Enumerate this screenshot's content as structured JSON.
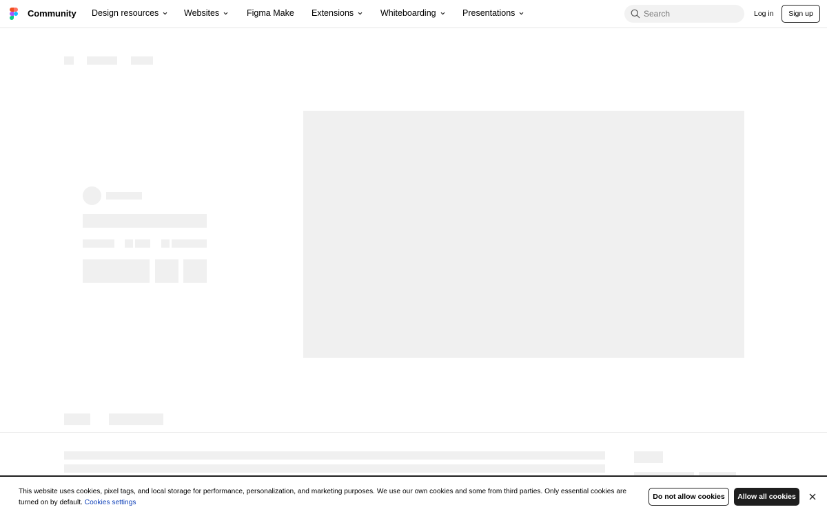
{
  "header": {
    "brand": "Community",
    "nav": [
      {
        "label": "Design resources",
        "has_dropdown": true
      },
      {
        "label": "Websites",
        "has_dropdown": true
      },
      {
        "label": "Figma Make",
        "has_dropdown": false
      },
      {
        "label": "Extensions",
        "has_dropdown": true
      },
      {
        "label": "Whiteboarding",
        "has_dropdown": true
      },
      {
        "label": "Presentations",
        "has_dropdown": true
      }
    ],
    "search_placeholder": "Search",
    "login_label": "Log in",
    "signup_label": "Sign up"
  },
  "cookie_banner": {
    "message": "This website uses cookies, pixel tags, and local storage for performance, personalization, and marketing purposes. We use our own cookies and some from third parties. Only essential cookies are turned on by default.",
    "settings_link": "Cookies settings",
    "deny_label": "Do not allow cookies",
    "allow_label": "Allow all cookies"
  },
  "icons": {
    "logo": "figma-logo-icon",
    "search": "search-icon",
    "chevron": "chevron-down-icon",
    "close": "close-icon"
  },
  "colors": {
    "skeleton": "#f0f0f0",
    "text": "#000000",
    "link": "#0d3fb8",
    "button_dark": "#1e1e1e"
  }
}
